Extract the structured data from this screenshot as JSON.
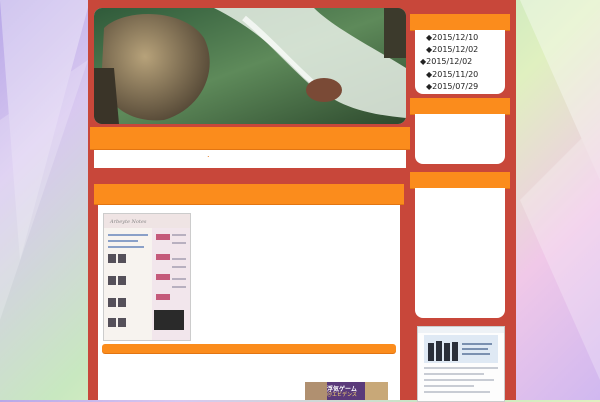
{
  "sidebar": {
    "archive_dates": [
      "◆2015/12/10",
      "◆2015/12/02",
      "◆2015/12/02",
      "◆2015/11/20",
      "◆2015/07/29"
    ]
  },
  "main": {
    "dot_marker": "."
  },
  "ad": {
    "game_title": "浮気ゲーム",
    "game_subtitle": "＠エビデンス"
  },
  "colors": {
    "page_bg": "#c8473a",
    "accent": "#fb8c1c"
  }
}
